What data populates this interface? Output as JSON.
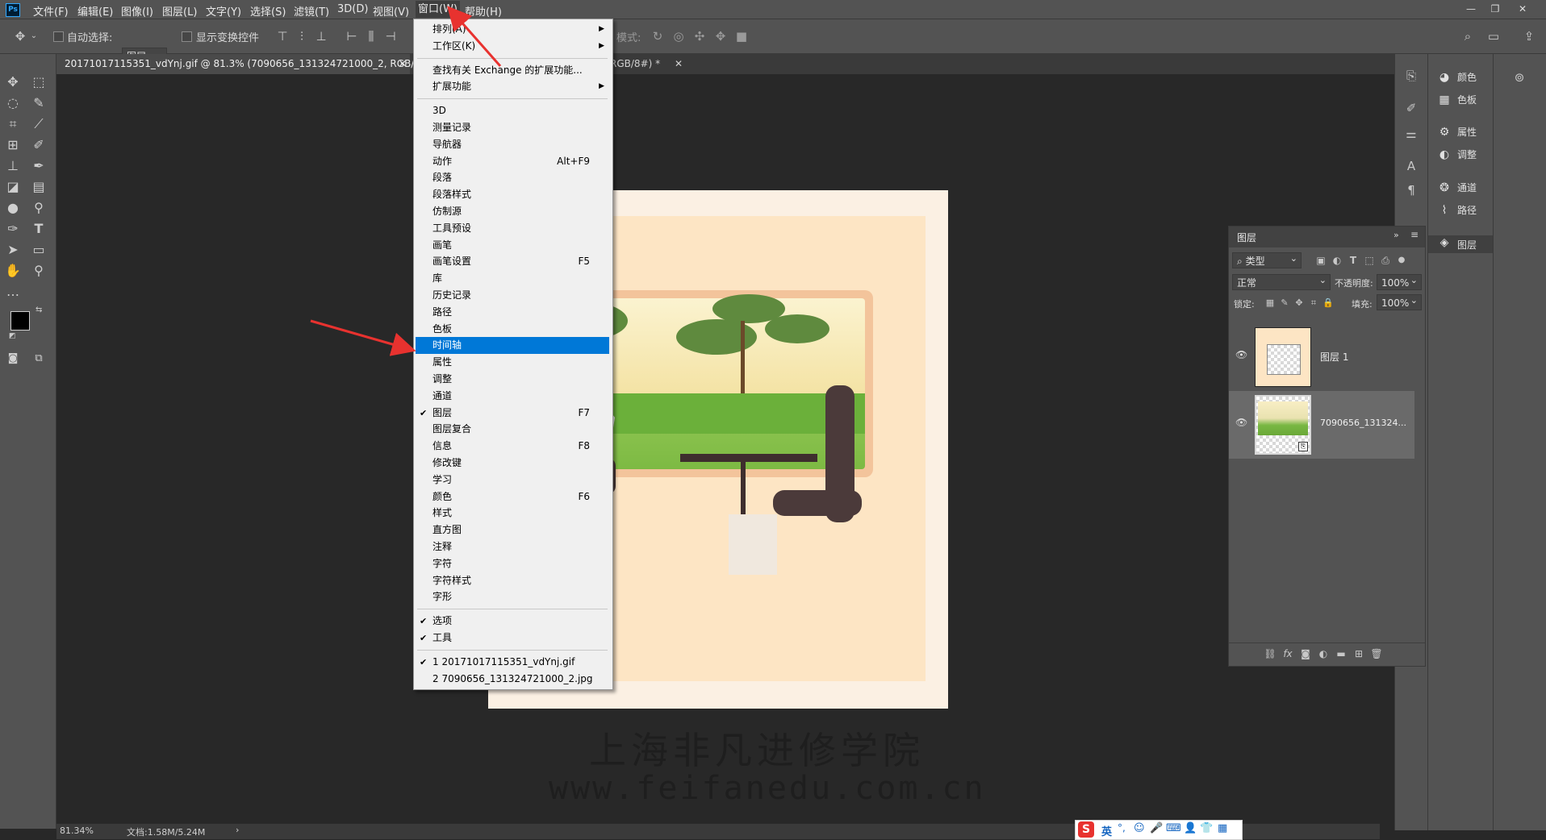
{
  "menubar": {
    "logo": "Ps",
    "items": [
      "文件(F)",
      "编辑(E)",
      "图像(I)",
      "图层(L)",
      "文字(Y)",
      "选择(S)",
      "滤镜(T)",
      "3D(D)",
      "视图(V)",
      "窗口(W)",
      "帮助(H)"
    ],
    "active_index": 9,
    "window_controls": [
      "—",
      "❐",
      "✕"
    ]
  },
  "options": {
    "auto_select_label": "自动选择:",
    "auto_select_value": "图层",
    "show_transform_label": "显示变换控件",
    "mode_label": "模式:"
  },
  "tabs": [
    {
      "label": "20171017115351_vdYnj.gif @ 81.3% (7090656_131324721000_2, RGB/8) *",
      "active": true
    },
    {
      "label": "RGB/8#) *",
      "active": false
    }
  ],
  "window_menu": {
    "items": [
      {
        "label": "排列(A)",
        "submenu": true
      },
      {
        "label": "工作区(K)",
        "submenu": true
      },
      {
        "sep": true
      },
      {
        "label": "查找有关 Exchange 的扩展功能..."
      },
      {
        "label": "扩展功能",
        "submenu": true
      },
      {
        "sep": true
      },
      {
        "label": "3D"
      },
      {
        "label": "测量记录"
      },
      {
        "label": "导航器"
      },
      {
        "label": "动作",
        "shortcut": "Alt+F9"
      },
      {
        "label": "段落"
      },
      {
        "label": "段落样式"
      },
      {
        "label": "仿制源"
      },
      {
        "label": "工具预设"
      },
      {
        "label": "画笔"
      },
      {
        "label": "画笔设置",
        "shortcut": "F5"
      },
      {
        "label": "库"
      },
      {
        "label": "历史记录"
      },
      {
        "label": "路径"
      },
      {
        "label": "色板"
      },
      {
        "label": "时间轴",
        "highlight": true
      },
      {
        "label": "属性"
      },
      {
        "label": "调整"
      },
      {
        "label": "通道"
      },
      {
        "label": "图层",
        "shortcut": "F7",
        "checked": true
      },
      {
        "label": "图层复合"
      },
      {
        "label": "信息",
        "shortcut": "F8"
      },
      {
        "label": "修改键"
      },
      {
        "label": "学习"
      },
      {
        "label": "颜色",
        "shortcut": "F6"
      },
      {
        "label": "样式"
      },
      {
        "label": "直方图"
      },
      {
        "label": "注释"
      },
      {
        "label": "字符"
      },
      {
        "label": "字符样式"
      },
      {
        "label": "字形"
      },
      {
        "sep": true
      },
      {
        "label": "选项",
        "checked": true
      },
      {
        "label": "工具",
        "checked": true
      },
      {
        "sep": true
      },
      {
        "label": "1 20171017115351_vdYnj.gif",
        "checked": true
      },
      {
        "label": "2 7090656_131324721000_2.jpg"
      }
    ]
  },
  "right_panels": [
    {
      "label": "颜色",
      "icon": "color-icon"
    },
    {
      "label": "色板",
      "icon": "swatches-icon"
    },
    {
      "label": "属性",
      "icon": "properties-icon"
    },
    {
      "label": "调整",
      "icon": "adjustments-icon"
    },
    {
      "label": "通道",
      "icon": "channels-icon"
    },
    {
      "label": "路径",
      "icon": "paths-icon"
    },
    {
      "label": "图层",
      "icon": "layers-icon"
    }
  ],
  "layers_panel": {
    "title": "图层",
    "filter": "类型",
    "blend_mode": "正常",
    "opacity_label": "不透明度:",
    "opacity": "100%",
    "lock_label": "锁定:",
    "fill_label": "填充:",
    "fill": "100%",
    "layers": [
      {
        "name": "图层 1",
        "selected": false
      },
      {
        "name": "7090656_131324...",
        "selected": true
      }
    ]
  },
  "statusbar": {
    "zoom": "81.34%",
    "doc": "文档:1.58M/5.24M",
    "arrow": "›"
  },
  "watermark": {
    "line1": "上海非凡进修学院",
    "line2": "www.feifanedu.com.cn"
  },
  "ime": {
    "logo": "S",
    "lang": "英"
  },
  "colors": {
    "menu_highlight": "#0078d7",
    "annotation_arrow": "#e8322f"
  }
}
